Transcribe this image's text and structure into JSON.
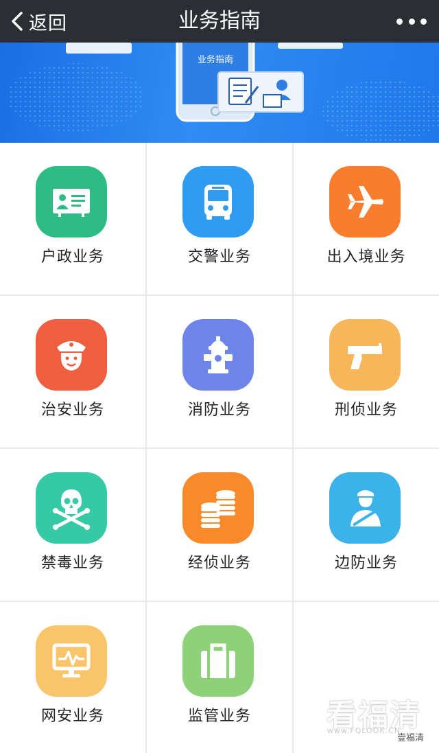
{
  "navbar": {
    "back_label": "返回",
    "title": "业务指南"
  },
  "banner": {
    "phone_text": "业务指南"
  },
  "services": [
    {
      "label": "户政业务",
      "color": "#2dbd84",
      "icon": "id-card-icon"
    },
    {
      "label": "交警业务",
      "color": "#2f9cf3",
      "icon": "bus-icon"
    },
    {
      "label": "出入境业务",
      "color": "#f97d2c",
      "icon": "airplane-icon"
    },
    {
      "label": "治安业务",
      "color": "#ee5e3f",
      "icon": "police-officer-icon"
    },
    {
      "label": "消防业务",
      "color": "#6d85ea",
      "icon": "fire-hydrant-icon"
    },
    {
      "label": "刑侦业务",
      "color": "#f8b65a",
      "icon": "pistol-icon"
    },
    {
      "label": "禁毒业务",
      "color": "#35c9a5",
      "icon": "skull-crossbones-icon"
    },
    {
      "label": "经侦业务",
      "color": "#f98a2a",
      "icon": "coins-icon"
    },
    {
      "label": "边防业务",
      "color": "#3bb2ea",
      "icon": "border-guard-icon"
    },
    {
      "label": "网安业务",
      "color": "#f9c46a",
      "icon": "monitor-pulse-icon"
    },
    {
      "label": "监管业务",
      "color": "#8dd179",
      "icon": "briefcase-icon"
    }
  ],
  "watermark": {
    "logo_text": "看福清",
    "url_text": "www.FQLOOK.CN",
    "account_text": "壹福清"
  }
}
